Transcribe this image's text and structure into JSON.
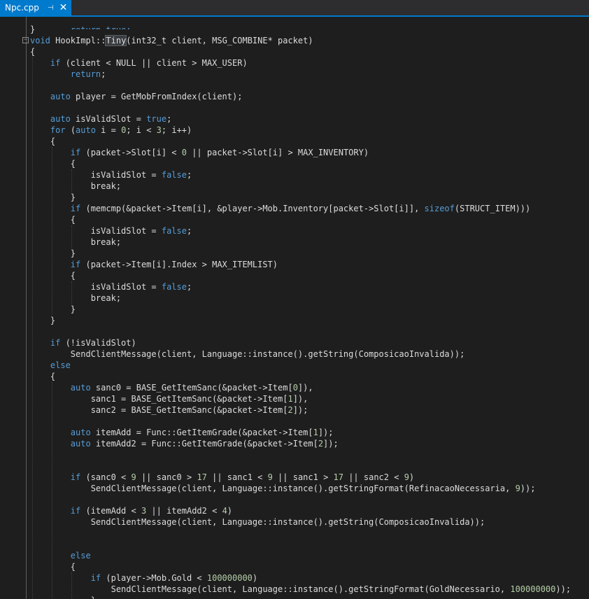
{
  "tab": {
    "title": "Npc.cpp",
    "pin_glyph": "⊣",
    "close_glyph": "✕"
  },
  "code_lines": [
    "}",
    "void HookImpl::Tiny(int32_t client, MSG_COMBINE* packet)",
    "{",
    "    if (client < NULL || client > MAX_USER)",
    "        return;",
    "",
    "    auto player = GetMobFromIndex(client);",
    "",
    "    auto isValidSlot = true;",
    "    for (auto i = 0; i < 3; i++)",
    "    {",
    "        if (packet->Slot[i] < 0 || packet->Slot[i] > MAX_INVENTORY)",
    "        {",
    "            isValidSlot = false;",
    "            break;",
    "        }",
    "        if (memcmp(&packet->Item[i], &player->Mob.Inventory[packet->Slot[i]], sizeof(STRUCT_ITEM)))",
    "        {",
    "            isValidSlot = false;",
    "            break;",
    "        }",
    "        if (packet->Item[i].Index > MAX_ITEMLIST)",
    "        {",
    "            isValidSlot = false;",
    "            break;",
    "        }",
    "    }",
    "",
    "    if (!isValidSlot)",
    "        SendClientMessage(client, Language::instance().getString(ComposicaoInvalida));",
    "    else",
    "    {",
    "        auto sanc0 = BASE_GetItemSanc(&packet->Item[0]),",
    "            sanc1 = BASE_GetItemSanc(&packet->Item[1]),",
    "            sanc2 = BASE_GetItemSanc(&packet->Item[2]);",
    "",
    "        auto itemAdd = Func::GetItemGrade(&packet->Item[1]);",
    "        auto itemAdd2 = Func::GetItemGrade(&packet->Item[2]);",
    "",
    "",
    "        if (sanc0 < 9 || sanc0 > 17 || sanc1 < 9 || sanc1 > 17 || sanc2 < 9)",
    "            SendClientMessage(client, Language::instance().getStringFormat(RefinacaoNecessaria, 9));",
    "",
    "        if (itemAdd < 3 || itemAdd2 < 4)",
    "            SendClientMessage(client, Language::instance().getString(ComposicaoInvalida));",
    "",
    "",
    "        else",
    "        {",
    "            if (player->Mob.Gold < 100000000)",
    "                SendClientMessage(client, Language::instance().getStringFormat(GoldNecessario, 100000000));",
    "            }"
  ],
  "partial_top_line": "        return true;",
  "highlighted_word": "Tiny",
  "colors": {
    "keyword": "#569cd6",
    "number": "#b5cea8",
    "text": "#dcdcdc",
    "background": "#1e1e1e",
    "tab_active": "#007acc"
  }
}
